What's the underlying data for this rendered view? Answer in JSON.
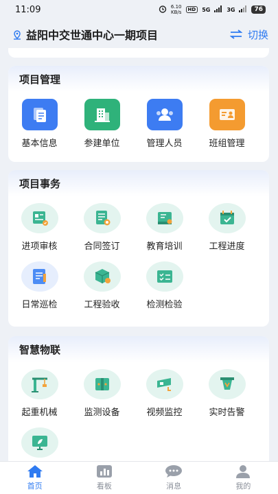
{
  "status_bar": {
    "time": "11:09",
    "net_speed_value": "6.10",
    "net_speed_unit": "KB/s",
    "hd": "HD",
    "sig1": "5G",
    "sig2": "3G",
    "battery": "76"
  },
  "header": {
    "title": "益阳中交世通中心一期项目",
    "switch_label": "切换"
  },
  "sections": {
    "project_mgmt": {
      "title": "项目管理",
      "items": [
        {
          "label": "基本信息",
          "icon": "document-icon",
          "color": "#3d7cf2"
        },
        {
          "label": "参建单位",
          "icon": "building-icon",
          "color": "#2fb27a"
        },
        {
          "label": "管理人员",
          "icon": "people-icon",
          "color": "#3d7cf2"
        },
        {
          "label": "班组管理",
          "icon": "id-card-icon",
          "color": "#f49b30"
        }
      ]
    },
    "project_affairs": {
      "title": "项目事务",
      "items": [
        {
          "label": "进项审核",
          "icon": "review-icon"
        },
        {
          "label": "合同签订",
          "icon": "contract-icon"
        },
        {
          "label": "教育培训",
          "icon": "book-icon"
        },
        {
          "label": "工程进度",
          "icon": "calendar-check-icon"
        },
        {
          "label": "日常巡检",
          "icon": "checklist-icon"
        },
        {
          "label": "工程验收",
          "icon": "box-check-icon"
        },
        {
          "label": "检测检验",
          "icon": "inspection-board-icon"
        }
      ]
    },
    "smart_iot": {
      "title": "智慧物联",
      "items": [
        {
          "label": "起重机械",
          "icon": "crane-icon"
        },
        {
          "label": "监测设备",
          "icon": "monitor-device-icon"
        },
        {
          "label": "视频监控",
          "icon": "camera-icon"
        },
        {
          "label": "实时告警",
          "icon": "alarm-icon"
        },
        {
          "label": "",
          "icon": "screen-leaf-icon"
        }
      ]
    }
  },
  "tabbar": {
    "home": "首页",
    "board": "看板",
    "messages": "消息",
    "mine": "我的"
  },
  "colors": {
    "accent": "#2f7bf1",
    "green": "#2fb27a",
    "orange": "#f49b30"
  }
}
